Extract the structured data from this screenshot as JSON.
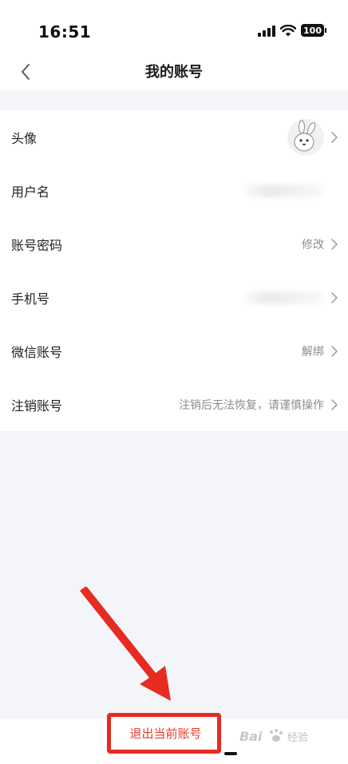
{
  "status_bar": {
    "time": "16:51",
    "battery": "100"
  },
  "nav": {
    "title": "我的账号"
  },
  "rows": [
    {
      "label": "头像"
    },
    {
      "label": "用户名"
    },
    {
      "label": "账号密码",
      "value": "修改"
    },
    {
      "label": "手机号"
    },
    {
      "label": "微信账号",
      "value": "解绑"
    },
    {
      "label": "注销账号",
      "value": "注销后无法恢复，请谨慎操作"
    }
  ],
  "logout": {
    "label": "退出当前账号"
  },
  "colors": {
    "accent": "#e43a2b",
    "annotation": "#e62b22",
    "background": "#f4f5f8"
  },
  "watermark": {
    "text": "经验"
  }
}
